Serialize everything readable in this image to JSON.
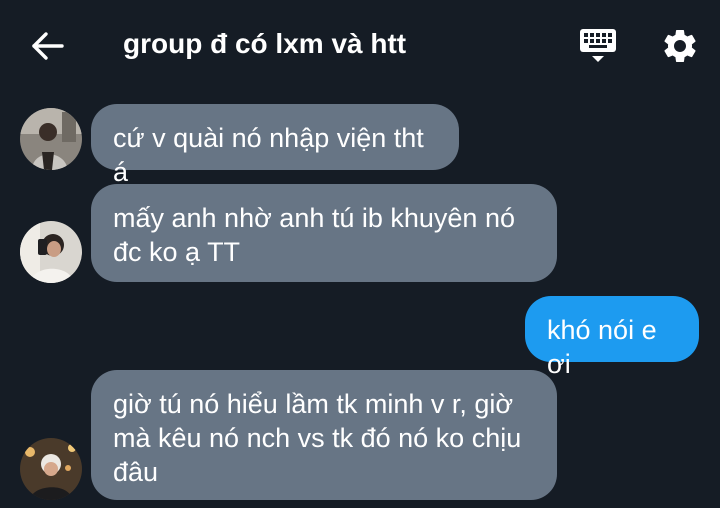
{
  "header": {
    "title": "group đ có lxm và htt",
    "back_icon": "back-arrow-icon",
    "keyboard_icon": "keyboard-icon",
    "settings_icon": "gear-icon"
  },
  "messages": [
    {
      "direction": "incoming",
      "lines": [
        "cứ v quài nó nhập viện tht á"
      ],
      "avatar": "avatar-1"
    },
    {
      "direction": "incoming",
      "lines": [
        "mấy anh nhờ anh tú ib khuyên nó",
        "đc ko ạ TT"
      ],
      "avatar": "avatar-2"
    },
    {
      "direction": "outgoing",
      "lines": [
        "khó nói e ơi"
      ]
    },
    {
      "direction": "incoming",
      "lines": [
        "giờ tú nó hiểu lầm tk minh v r, giờ",
        "mà kêu nó nch vs tk đó nó ko chịu",
        "đâu"
      ],
      "avatar": "avatar-3"
    }
  ],
  "colors": {
    "background": "#151c25",
    "incoming_bubble": "#677585",
    "outgoing_bubble": "#1d9bf0",
    "text": "#ffffff"
  }
}
